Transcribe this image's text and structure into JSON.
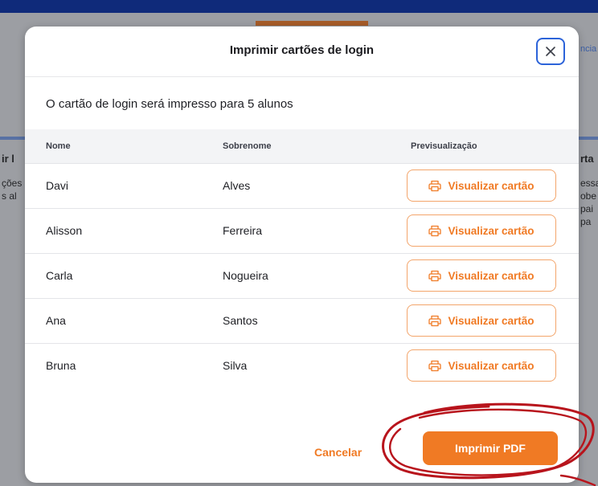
{
  "background": {
    "left_heading": "ir l",
    "left_lines": [
      "ções",
      "s al"
    ],
    "right_heading": "rta",
    "right_lines": [
      "essa",
      "obe",
      "pai",
      "pa"
    ],
    "right_hint": "ncia"
  },
  "modal": {
    "title": "Imprimir cartões de login",
    "subtitle": "O cartão de login será impresso para 5 alunos",
    "columns": [
      "Nome",
      "Sobrenome",
      "Previsualização"
    ],
    "rows": [
      {
        "first": "Davi",
        "last": "Alves",
        "action": "Visualizar cartão"
      },
      {
        "first": "Alisson",
        "last": "Ferreira",
        "action": "Visualizar cartão"
      },
      {
        "first": "Carla",
        "last": "Nogueira",
        "action": "Visualizar cartão"
      },
      {
        "first": "Ana",
        "last": "Santos",
        "action": "Visualizar cartão"
      },
      {
        "first": "Bruna",
        "last": "Silva",
        "action": "Visualizar cartão"
      }
    ],
    "cancel_label": "Cancelar",
    "print_label": "Imprimir PDF",
    "close_icon": "close-icon",
    "row_icon": "printer-icon"
  },
  "colors": {
    "accent": "#f07a24",
    "close_border": "#2c63d9",
    "annotation": "#b8141c"
  }
}
